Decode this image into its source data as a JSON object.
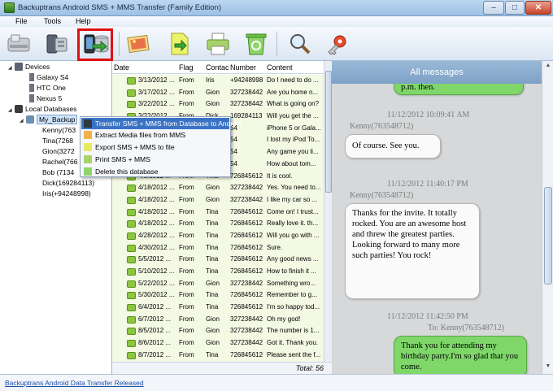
{
  "window": {
    "title": "Backuptrans Android SMS + MMS Transfer (Family Edition)",
    "minimize": "–",
    "maximize": "□",
    "close": "✕"
  },
  "menu": [
    "File",
    "Tools",
    "Help"
  ],
  "toolbar": {
    "icons": [
      "devices-icon",
      "phone-backup-icon",
      "transfer-db-to-android-icon",
      "export-media-icon",
      "export-file-icon",
      "print-icon",
      "recycle-icon",
      "search-icon",
      "key-icon"
    ],
    "highlight_color": "#e01010"
  },
  "tree": {
    "devices": "Devices",
    "device_items": [
      "Galaxy S4",
      "HTC One",
      "Nexus 5"
    ],
    "local_db": "Local Databases",
    "backup": "My_Backup",
    "contacts": [
      "Kenny(763",
      "Tina(7268",
      "Gion(3272",
      "Rachel(766",
      "Bob (7134",
      "Dick(169284113)",
      "Iris(+94248998)"
    ]
  },
  "context_menu": [
    "Transfer SMS + MMS from Database to Android",
    "Extract Media files from MMS",
    "Export SMS + MMS to file",
    "Print SMS + MMS",
    "Delete this database"
  ],
  "table": {
    "headers": [
      "Date",
      "Flag",
      "Contac",
      "Number",
      "Content"
    ],
    "rows": [
      [
        "3/13/2012 ...",
        "From",
        "Iris",
        "+94248998",
        "Do I need to do ..."
      ],
      [
        "3/17/2012 ...",
        "From",
        "Gion",
        "327238442",
        "Are you home n..."
      ],
      [
        "3/22/2012 ...",
        "From",
        "Gion",
        "327238442",
        "What is going on?"
      ],
      [
        "3/22/2012 ...",
        "From",
        "Dick",
        "169284113",
        "Will you get the ..."
      ],
      [
        "",
        "",
        "",
        "54",
        "iPhone 5 or Gala..."
      ],
      [
        "",
        "",
        "",
        "54",
        "I lost my iPod To..."
      ],
      [
        "",
        "",
        "",
        "54",
        "Any game you li..."
      ],
      [
        "",
        "",
        "",
        "54",
        "How about tom..."
      ],
      [
        "4/8/2012 ...",
        "From",
        "Tina",
        "726845612",
        "It is cool."
      ],
      [
        "4/18/2012 ...",
        "From",
        "Gion",
        "327238442",
        "Yes. You need to..."
      ],
      [
        "4/18/2012 ...",
        "From",
        "Gion",
        "327238442",
        "I like my car so ..."
      ],
      [
        "4/18/2012 ...",
        "From",
        "Tina",
        "726845612",
        "Come on! I trust..."
      ],
      [
        "4/18/2012 ...",
        "From",
        "Tina",
        "726845612",
        "Really love it. th..."
      ],
      [
        "4/28/2012 ...",
        "From",
        "Tina",
        "726845612",
        "Will you go with ..."
      ],
      [
        "4/30/2012 ...",
        "From",
        "Tina",
        "726845612",
        "Sure."
      ],
      [
        "5/5/2012 ...",
        "From",
        "Tina",
        "726845612",
        "Any good news ..."
      ],
      [
        "5/10/2012 ...",
        "From",
        "Tina",
        "726845612",
        "How to finish it ..."
      ],
      [
        "5/22/2012 ...",
        "From",
        "Gion",
        "327238442",
        "Something wro..."
      ],
      [
        "5/30/2012 ...",
        "From",
        "Tina",
        "726845612",
        "Remember to g..."
      ],
      [
        "6/4/2012 ...",
        "From",
        "Tina",
        "726845612",
        "I'm so happy tod..."
      ],
      [
        "6/7/2012 ...",
        "From",
        "Gion",
        "327238442",
        "Oh my god!"
      ],
      [
        "8/5/2012 ...",
        "From",
        "Gion",
        "327238442",
        "The number is 1..."
      ],
      [
        "8/6/2012 ...",
        "From",
        "Gion",
        "327238442",
        "Got it. Thank you."
      ],
      [
        "8/7/2012 ...",
        "From",
        "Tina",
        "726845612",
        "Please sent the f..."
      ],
      [
        "8/12/2012 ...",
        "From",
        "Tina",
        "726845612",
        "You are so kind. ..."
      ]
    ],
    "total": "Total: 56"
  },
  "chat": {
    "header": "All messages",
    "messages": [
      {
        "kind": "out",
        "text": "p.m. then."
      },
      {
        "kind": "ts",
        "text": "11/12/2012 10:09:41 AM"
      },
      {
        "kind": "who",
        "text": "Kenny(763548712)"
      },
      {
        "kind": "in",
        "text": "Of course. See you."
      },
      {
        "kind": "ts",
        "text": "11/12/2012 11:40:17 PM"
      },
      {
        "kind": "who",
        "text": "Kenny(763548712)"
      },
      {
        "kind": "in",
        "text": "Thanks for the invite. It totally rocked. You are an awesome host and threw the greatest parties. Looking forward to many more such parties! You rock!"
      },
      {
        "kind": "ts",
        "text": "11/12/2012 11:42:50 PM"
      },
      {
        "kind": "to",
        "text": "To: Kenny(763548712)"
      },
      {
        "kind": "out",
        "text": "Thank you for attending my birthday party.I'm so glad that you come."
      }
    ]
  },
  "status": {
    "link": "Backuptrans Android Data Transfer Released"
  }
}
